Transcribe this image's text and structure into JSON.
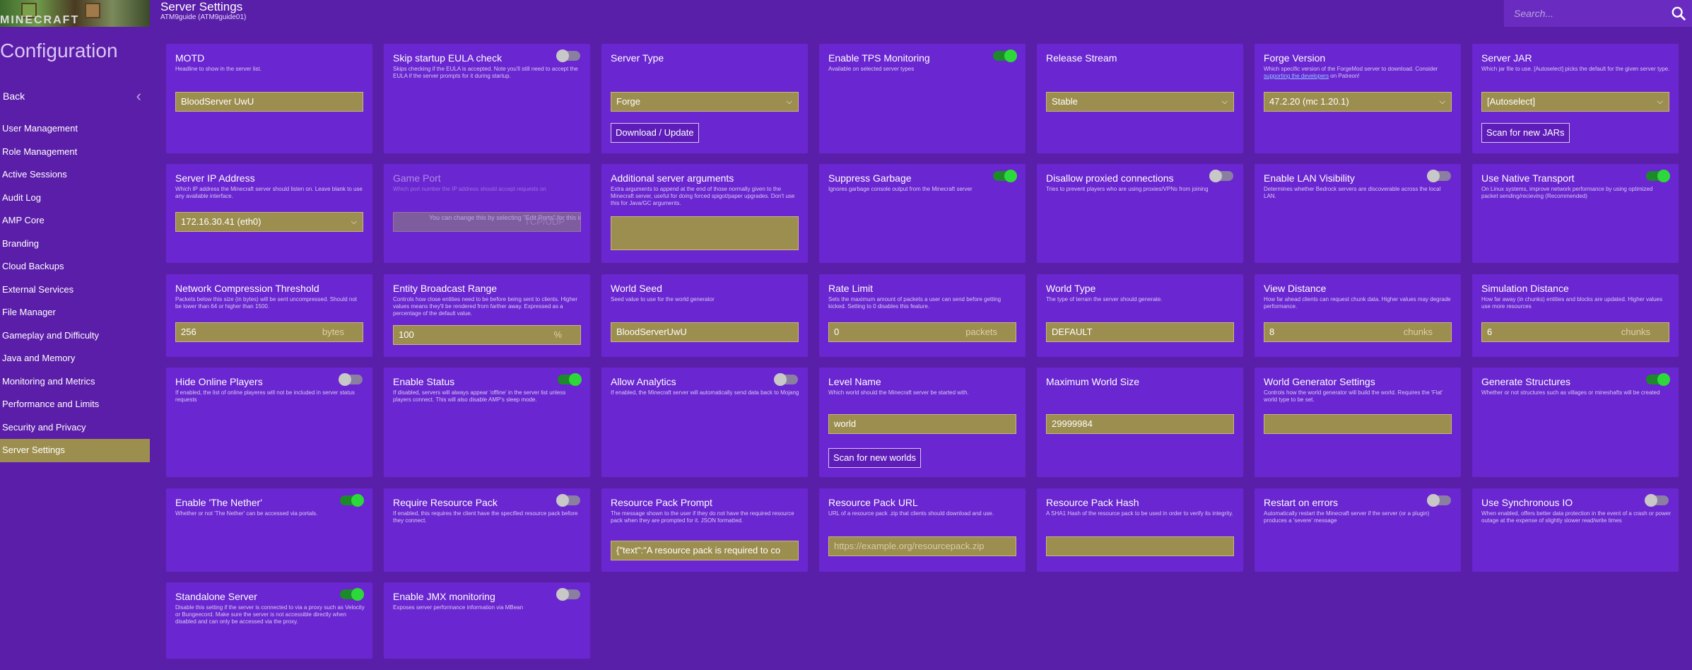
{
  "header": {
    "title": "Server Settings",
    "subtitle": "ATM9guide (ATM9guide01)",
    "search_placeholder": "Search..."
  },
  "sidebar": {
    "logo_text": "MINECRAFT",
    "config_title": "Configuration",
    "back_label": "Back",
    "items": [
      {
        "label": "User Management"
      },
      {
        "label": "Role Management"
      },
      {
        "label": "Active Sessions"
      },
      {
        "label": "Audit Log"
      },
      {
        "label": "AMP Core"
      },
      {
        "label": "Branding"
      },
      {
        "label": "Cloud Backups"
      },
      {
        "label": "External Services"
      },
      {
        "label": "File Manager"
      },
      {
        "label": "Gameplay and Difficulty"
      },
      {
        "label": "Java and Memory"
      },
      {
        "label": "Monitoring and Metrics"
      },
      {
        "label": "Performance and Limits"
      },
      {
        "label": "Security and Privacy"
      },
      {
        "label": "Server Settings",
        "active": true
      }
    ]
  },
  "colors": {
    "background": "#5a1fa8",
    "card": "#6a26d0",
    "field": "#9c8e4f",
    "toggle_on": "#2dd93a",
    "toggle_off": "#c8c8c8"
  },
  "cards": {
    "motd": {
      "title": "MOTD",
      "desc": "Headline to show in the server list.",
      "value": "BloodServer UwU"
    },
    "eula": {
      "title": "Skip startup EULA check",
      "desc": "Skips checking if the EULA is accepted. Note you'll still need to accept the EULA if the server prompts for it during startup.",
      "toggle": false
    },
    "server_type": {
      "title": "Server Type",
      "value": "Forge",
      "button": "Download / Update"
    },
    "tps": {
      "title": "Enable TPS Monitoring",
      "desc": "Available on selected server types",
      "toggle": true
    },
    "release_stream": {
      "title": "Release Stream",
      "value": "Stable"
    },
    "forge_version": {
      "title": "Forge Version",
      "desc_pre": "Which specific version of the ForgeMod server to download. Consider ",
      "desc_link": "supporting the developers",
      "desc_post": " on Patreon!",
      "value": "47.2.20 (mc 1.20.1)"
    },
    "server_jar": {
      "title": "Server JAR",
      "desc": "Which jar file to use. [Autoselect] picks the default for the given server type.",
      "value": "[Autoselect]",
      "button": "Scan for new JARs"
    },
    "ip": {
      "title": "Server IP Address",
      "desc": "Which IP address the Minecraft server should listen on. Leave blank to use any available interface.",
      "value": "172.16.30.41 (eth0)"
    },
    "port": {
      "title": "Game Port",
      "desc": "Which port number the IP address should accept requests on",
      "overlay": "You can change this by selecting \"Edit Ports\" for this instance in ADS",
      "ghost": "TCP/UDP"
    },
    "args": {
      "title": "Additional server arguments",
      "desc": "Extra arguments to append at the end of those normally given to the Minecraft server, useful for doing forced spigot/paper upgrades. Don't use this for Java/GC arguments.",
      "value": ""
    },
    "garbage": {
      "title": "Suppress Garbage",
      "desc": "Ignores garbage console output from the Minecraft server",
      "toggle": true
    },
    "proxied": {
      "title": "Disallow proxied connections",
      "desc": "Tries to prevent players who are using proxies/VPNs from joining",
      "toggle": false
    },
    "lan": {
      "title": "Enable LAN Visibility",
      "desc": "Determines whether Bedrock servers are discoverable across the local LAN.",
      "toggle": false
    },
    "native": {
      "title": "Use Native Transport",
      "desc": "On Linux systems, improve network performance by using optimized packet sending/recieving (Recommended)",
      "toggle": true
    },
    "compression": {
      "title": "Network Compression Threshold",
      "desc": "Packets below this size (in bytes) will be sent uncompressed. Should not be lower than 64 or higher than 1500.",
      "value": "256",
      "unit": "bytes"
    },
    "entity": {
      "title": "Entity Broadcast Range",
      "desc": "Controls how close entities need to be before being sent to clients. Higher values means they'll be rendered from farther away. Expressed as a percentage of the default value.",
      "value": "100",
      "unit": "%"
    },
    "seed": {
      "title": "World Seed",
      "desc": "Seed value to use for the world generator",
      "value": "BloodServerUwU"
    },
    "rate": {
      "title": "Rate Limit",
      "desc": "Sets the maximum amount of packets a user can send before getting kicked. Setting to 0 disables this feature.",
      "value": "0",
      "unit": "packets"
    },
    "world_type": {
      "title": "World Type",
      "desc": "The type of terrain the server should generate.",
      "value": "DEFAULT"
    },
    "view": {
      "title": "View Distance",
      "desc": "How far ahead clients can request chunk data. Higher values may degrade performance.",
      "value": "8",
      "unit": "chunks"
    },
    "sim": {
      "title": "Simulation Distance",
      "desc": "How far away (in chunks) entities and blocks are updated. Higher values use more resources",
      "value": "6",
      "unit": "chunks"
    },
    "hide": {
      "title": "Hide Online Players",
      "desc": "If enabled, the list of online playeres will not be included in server status requests",
      "toggle": false
    },
    "status": {
      "title": "Enable Status",
      "desc": "If disabled, servers will always appear 'offline' in the server list unless players connect. This will also disable AMP's sleep mode.",
      "toggle": true
    },
    "analytics": {
      "title": "Allow Analytics",
      "desc": "If enabled, the Minecraft server will automatically send data back to Mojang",
      "toggle": false
    },
    "level": {
      "title": "Level Name",
      "desc": "Which world should the Minecraft server be started with.",
      "value": "world",
      "button": "Scan for new worlds"
    },
    "max_world": {
      "title": "Maximum World Size",
      "value": "29999984"
    },
    "gen_settings": {
      "title": "World Generator Settings",
      "desc": "Controls how the world generator will build the world. Requires the 'Flat' world type to be set.",
      "value": ""
    },
    "structures": {
      "title": "Generate Structures",
      "desc": "Whether or not structures such as villages or mineshafts will be created",
      "toggle": true
    },
    "nether": {
      "title": "Enable 'The Nether'",
      "desc": "Whether or not 'The Nether' can be accessed via portals.",
      "toggle": true
    },
    "require_rp": {
      "title": "Require Resource Pack",
      "desc": "If enabled, this requires the client have the specified resource pack before they connect.",
      "toggle": false
    },
    "rp_prompt": {
      "title": "Resource Pack Prompt",
      "desc": "The message shown to the user if they do not have the required resource pack when they are prompted for it. JSON formatted.",
      "value": "{\"text\":\"A resource pack is required to co"
    },
    "rp_url": {
      "title": "Resource Pack URL",
      "desc": "URL of a resource pack .zip that clients should download and use.",
      "placeholder": "https://example.org/resourcepack.zip"
    },
    "rp_hash": {
      "title": "Resource Pack Hash",
      "desc": "A SHA1 Hash of the resource pack to be used in order to verify its integrity.",
      "value": ""
    },
    "restart": {
      "title": "Restart on errors",
      "desc": "Automatically restart the Minecraft server if the server (or a plugin) produces a 'severe' message",
      "toggle": false
    },
    "sync_io": {
      "title": "Use Synchronous IO",
      "desc": "When enabled, offers better data protection in the event of a crash or power outage at the expense of slightly slower read/write times",
      "toggle": false
    },
    "standalone": {
      "title": "Standalone Server",
      "desc": "Disable this setting if the server is connected to via a proxy such as Velocity or Bungeecord. Make sure the server is not accessible directly when disabled and can only be accessed via the proxy.",
      "toggle": true
    },
    "jmx": {
      "title": "Enable JMX monitoring",
      "desc": "Exposes server performance information via MBean",
      "toggle": false
    }
  }
}
